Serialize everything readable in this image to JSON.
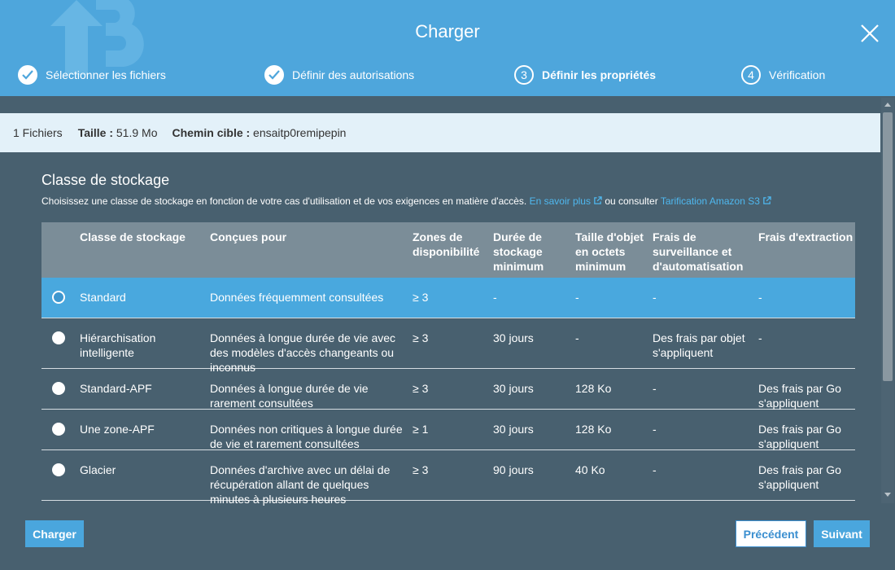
{
  "dialog": {
    "title": "Charger"
  },
  "steps": [
    {
      "number": "1",
      "label": "Sélectionner les fichiers",
      "state": "done"
    },
    {
      "number": "2",
      "label": "Définir des autorisations",
      "state": "done"
    },
    {
      "number": "3",
      "label": "Définir les propriétés",
      "state": "active"
    },
    {
      "number": "4",
      "label": "Vérification",
      "state": "pending"
    }
  ],
  "info": {
    "files": "1 Fichiers",
    "size_label": "Taille :",
    "size_value": " 51.9 Mo",
    "path_label": "Chemin cible :",
    "path_value": " ensaitp0remipepin"
  },
  "storage": {
    "title": "Classe de stockage",
    "description": "Choisissez une classe de stockage en fonction de votre cas d'utilisation et de vos exigences en matière d'accès.",
    "learn_more": "En savoir plus",
    "or_consult": "ou consulter",
    "pricing_link": "Tarification Amazon S3",
    "columns": [
      "Classe de stockage",
      "Conçues pour",
      "Zones de disponibilité",
      "Durée de stockage minimum",
      "Taille d'objet en octets minimum",
      "Frais de surveillance et d'automatisation",
      "Frais d'extraction"
    ],
    "rows": [
      {
        "cells": [
          "Standard",
          "Données fréquemment consultées",
          "≥ 3",
          "-",
          "-",
          "-",
          "-"
        ],
        "selected": true
      },
      {
        "cells": [
          "Hiérarchisation intelligente",
          "Données à longue durée de vie avec des modèles d'accès changeants ou inconnus",
          "≥ 3",
          "30 jours",
          "-",
          "Des frais par objet s'appliquent",
          "-"
        ],
        "selected": false
      },
      {
        "cells": [
          "Standard-APF",
          "Données à longue durée de vie rarement consultées",
          "≥ 3",
          "30 jours",
          "128 Ko",
          "-",
          "Des frais par Go s'appliquent"
        ],
        "selected": false
      },
      {
        "cells": [
          "Une zone-APF",
          "Données non critiques à longue durée de vie et rarement consultées",
          "≥ 1",
          "30 jours",
          "128 Ko",
          "-",
          "Des frais par Go s'appliquent"
        ],
        "selected": false
      },
      {
        "cells": [
          "Glacier",
          "Données d'archive avec un délai de récupération allant de quelques minutes à plusieurs heures",
          "≥ 3",
          "90 jours",
          "40 Ko",
          "-",
          "Des frais par Go s'appliquent"
        ],
        "selected": false
      }
    ]
  },
  "footer": {
    "upload_label": "Charger",
    "previous_label": "Précédent",
    "next_label": "Suivant"
  },
  "colors": {
    "header": "#4ea6dc",
    "body": "#48606f",
    "selected_row": "#49a8de",
    "link": "#4fb8ef",
    "table_header": "#7b8d98"
  },
  "icons": [
    "upload-logo-icon",
    "close-icon",
    "check-icon",
    "external-link-icon",
    "scroll-up-icon",
    "scroll-down-icon"
  ]
}
